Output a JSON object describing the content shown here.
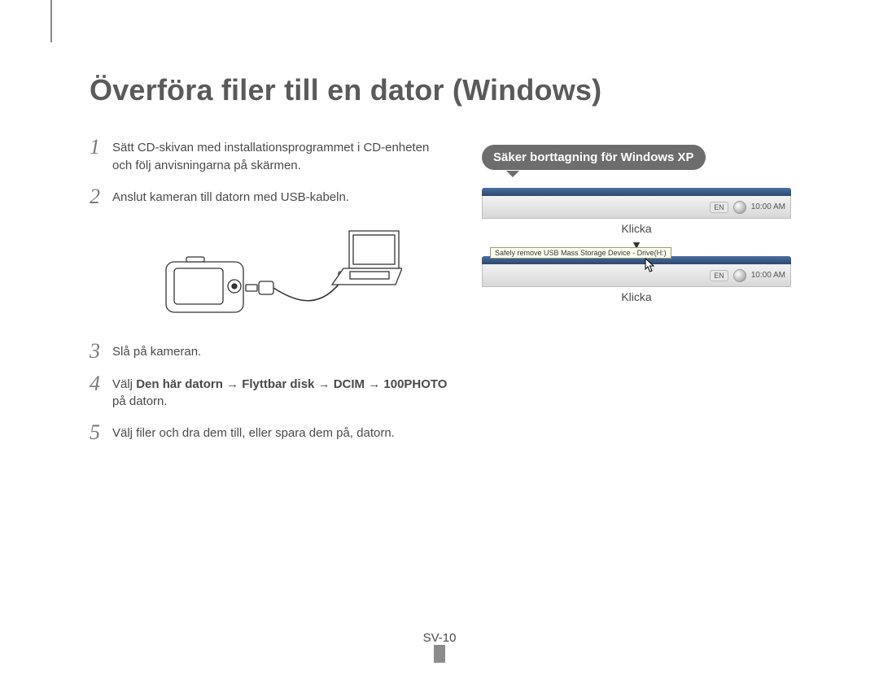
{
  "title": "Överföra filer till en dator (Windows)",
  "steps": [
    {
      "n": "1",
      "text": "Sätt CD-skivan med installationsprogrammet i CD-enheten och följ anvisningarna på skärmen."
    },
    {
      "n": "2",
      "text": "Anslut kameran till datorn med USB-kabeln."
    },
    {
      "n": "3",
      "text": "Slå på kameran."
    },
    {
      "n": "4",
      "text_pre": "Välj ",
      "bold": "Den här datorn → Flyttbar disk → DCIM → 100PHOTO",
      "text_post": " på datorn."
    },
    {
      "n": "5",
      "text": "Välj filer och dra dem till, eller spara dem på, datorn."
    }
  ],
  "callout": "Säker borttagning för Windows XP",
  "tray": {
    "lang": "EN",
    "time": "10:00 AM",
    "click": "Klicka",
    "tooltip": "Safely remove USB Mass Storage Device - Drive(H:)"
  },
  "pageNumber": "SV-10"
}
